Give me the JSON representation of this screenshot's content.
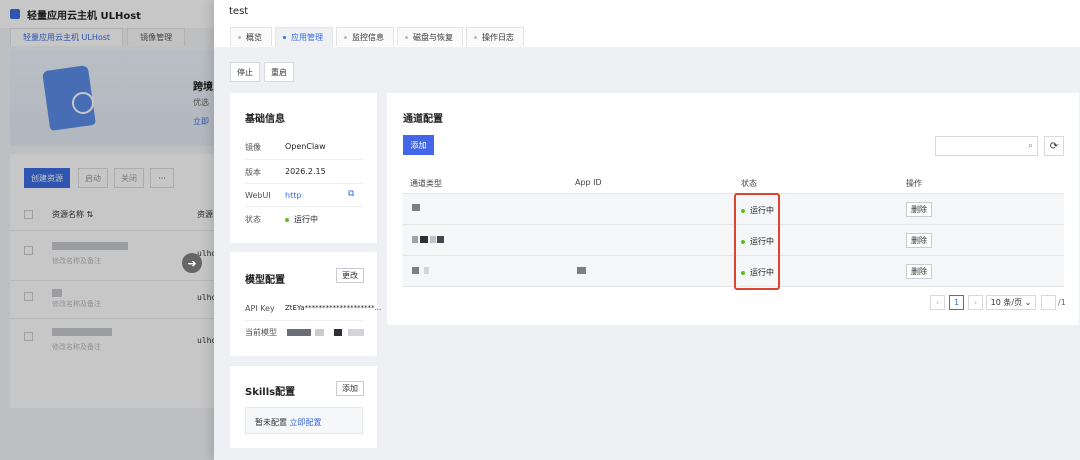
{
  "background": {
    "app_title": "轻量应用云主机 ULHost",
    "tabs": [
      {
        "label": "轻量应用云主机 ULHost",
        "active": true
      },
      {
        "label": "镜像管理",
        "active": false
      }
    ],
    "banner": {
      "title": "跨境",
      "subtitle": "优选",
      "link": "立即"
    },
    "create_button": "创建资源",
    "action_buttons": [
      "启动",
      "关闭",
      "···"
    ],
    "columns": [
      "资源名称",
      "资源"
    ],
    "rows": [
      {
        "sub": "修改名称及备注",
        "ul": "ulho"
      },
      {
        "sub": "修改名称及备注",
        "ul": "ulho"
      },
      {
        "sub": "修改名称及备注",
        "ul": "ulho"
      }
    ]
  },
  "drawer": {
    "title": "test",
    "tabs": [
      {
        "label": "概览",
        "active": false
      },
      {
        "label": "应用管理",
        "active": true
      },
      {
        "label": "监控信息",
        "active": false
      },
      {
        "label": "磁盘与恢复",
        "active": false
      },
      {
        "label": "操作日志",
        "active": false
      }
    ],
    "actions": {
      "stop": "停止",
      "restart": "重启"
    },
    "basic_info": {
      "title": "基础信息",
      "image_label": "镜像",
      "image_value": "OpenClaw",
      "version_label": "版本",
      "version_value": "2026.2.15",
      "webui_label": "WebUI",
      "webui_value": "http",
      "status_label": "状态",
      "status_value": "运行中"
    },
    "model_config": {
      "title": "模型配置",
      "edit_button": "更改",
      "api_key_label": "API Key",
      "api_key_value": "ZtEYa********************...",
      "current_model_label": "当前模型"
    },
    "skills_config": {
      "title": "Skills配置",
      "add_button": "添加",
      "empty_text": "暂未配置",
      "configure_link": "立即配置"
    },
    "channel_config": {
      "title": "通道配置",
      "add_button": "添加",
      "search_placeholder": "",
      "columns": {
        "type": "通道类型",
        "app_id": "App ID",
        "status": "状态",
        "action": "操作"
      },
      "rows": [
        {
          "status": "运行中",
          "action": "删除"
        },
        {
          "status": "运行中",
          "action": "删除"
        },
        {
          "status": "运行中",
          "action": "删除"
        }
      ],
      "pagination": {
        "current_page": "1",
        "page_size": "10 条/页",
        "total_pages": "/1"
      }
    }
  },
  "colors": {
    "accent": "#3b6de0",
    "primary_button": "#4466e8",
    "running": "#52c41a",
    "highlight": "#d9452f"
  }
}
